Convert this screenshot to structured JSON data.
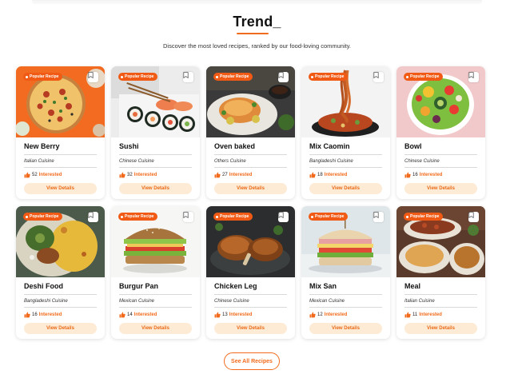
{
  "section": {
    "title": "Trend_",
    "subtitle": "Discover the most loved recipes, ranked by our food-loving community."
  },
  "labels": {
    "badge": "Popular Recipe",
    "interested": "Interested",
    "view_details": "View Details"
  },
  "colors": {
    "accent": "#f26b1d",
    "badge_bg": "#f05a14",
    "button_bg": "#fdebd6"
  },
  "recipes": [
    {
      "name": "New Berry",
      "cuisine": "Italian Cuisine",
      "interested": "52",
      "image": "pizza"
    },
    {
      "name": "Sushi",
      "cuisine": "Chinese Cuisine",
      "interested": "32",
      "image": "sushi"
    },
    {
      "name": "Oven baked",
      "cuisine": "Others Cuisine",
      "interested": "27",
      "image": "baked-salmon"
    },
    {
      "name": "Mix Caomin",
      "cuisine": "Bangladeshi Cuisine",
      "interested": "18",
      "image": "noodles"
    },
    {
      "name": "Bowl",
      "cuisine": "Chinese Cuisine",
      "interested": "16",
      "image": "salad-bowl"
    },
    {
      "name": "Deshi Food",
      "cuisine": "Bangladeshi Cuisine",
      "interested": "16",
      "image": "rice-platter"
    },
    {
      "name": "Burgur Pan",
      "cuisine": "Mexican Cuisine",
      "interested": "14",
      "image": "sandwich"
    },
    {
      "name": "Chicken Leg",
      "cuisine": "Chinese Cuisine",
      "interested": "13",
      "image": "roast-chicken"
    },
    {
      "name": "Mix San",
      "cuisine": "Mexican Cuisine",
      "interested": "12",
      "image": "club-sandwich"
    },
    {
      "name": "Meal",
      "cuisine": "Italian Cuisine",
      "interested": "11",
      "image": "meal-spread"
    }
  ],
  "footer": {
    "see_all": "See All Recipes"
  }
}
